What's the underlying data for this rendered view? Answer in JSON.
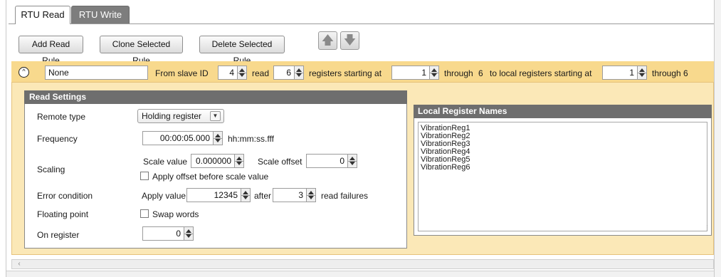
{
  "tabs": [
    {
      "label": "RTU Read",
      "active": true
    },
    {
      "label": "RTU Write",
      "active": false
    }
  ],
  "toolbar": {
    "add_label": "Add Read Rule",
    "clone_label": "Clone Selected Rule",
    "delete_label": "Delete Selected Rule",
    "move_up_icon": "arrow-up-icon",
    "move_down_icon": "arrow-down-icon"
  },
  "rule": {
    "name": "None",
    "from_slave_label": "From slave ID",
    "slave_id": "4",
    "read_label": "read",
    "count": "6",
    "registers_label": "registers starting at",
    "start": "1",
    "through_label": "through",
    "through_value": "6",
    "local_label": "to local registers starting at",
    "local_start": "1",
    "local_through_label": "through 6"
  },
  "read_settings": {
    "title": "Read Settings",
    "remote_type_label": "Remote type",
    "remote_type_value": "Holding register",
    "frequency_label": "Frequency",
    "frequency_value": "00:00:05.000",
    "frequency_format": "hh:mm:ss.fff",
    "scaling_label": "Scaling",
    "scale_value_label": "Scale value",
    "scale_value": "0.000000",
    "scale_offset_label": "Scale offset",
    "scale_offset": "0",
    "apply_offset_label": "Apply offset before scale value",
    "error_label": "Error condition",
    "apply_value_label": "Apply value",
    "apply_value": "12345",
    "after_label": "after",
    "failures": "3",
    "failures_label": "read failures",
    "floating_label": "Floating point",
    "swap_words_label": "Swap words",
    "on_register_label": "On register",
    "on_register": "0"
  },
  "local_names": {
    "title": "Local Register Names",
    "items": [
      "VibrationReg1",
      "VibrationReg2",
      "VibrationReg3",
      "VibrationReg4",
      "VibrationReg5",
      "VibrationReg6"
    ]
  },
  "colors": {
    "rule_header": "#f8d98d",
    "rule_body": "#fbe8b7",
    "panel_header": "#6e6e6e"
  }
}
